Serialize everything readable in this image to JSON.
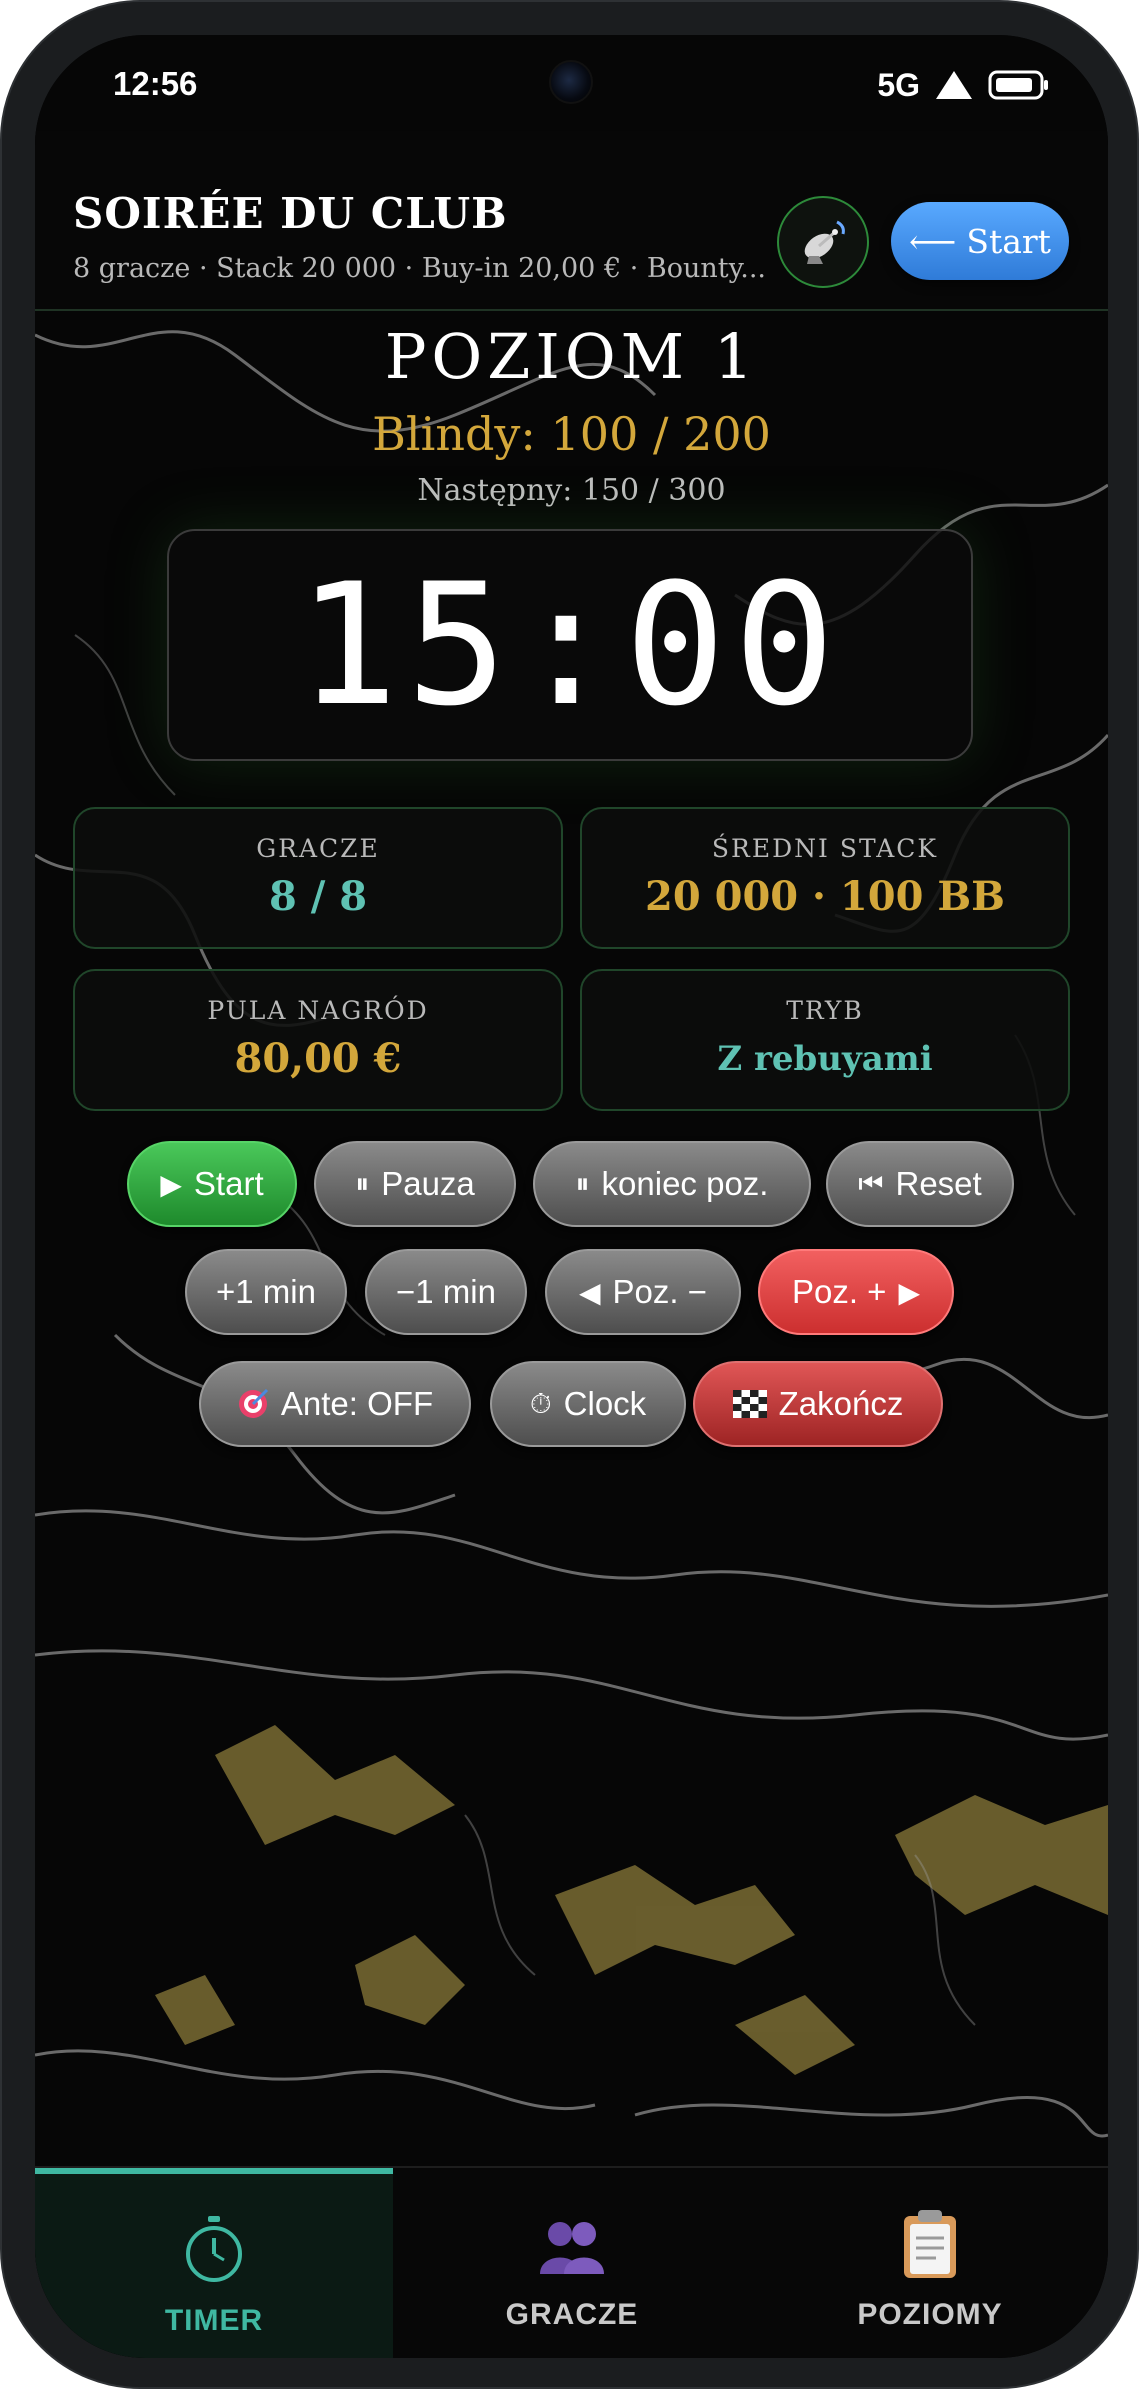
{
  "status_bar": {
    "time": "12:56",
    "network": "5G",
    "icons": [
      "signal-icon",
      "battery-icon"
    ]
  },
  "header": {
    "title": "SOIRÉE DU CLUB",
    "subtitle": "8 gracze · Stack 20 000 · Buy-in 20,00 € · Bounty...",
    "cast_icon": "satellite-dish-icon",
    "start_label": "Start",
    "start_icon": "arrow-left-icon",
    "start_color": "#3a8ae6"
  },
  "level": {
    "title": "POZIOM 1",
    "blinds": "Blindy: 100 / 200",
    "next": "Następny: 150 / 300"
  },
  "timer": {
    "display": "15:00"
  },
  "stats": {
    "players": {
      "label": "GRACZE",
      "value": "8 / 8",
      "color": "#5fc2b3"
    },
    "avg_stack": {
      "label": "ŚREDNI STACK",
      "value": "20 000 · 100 BB",
      "color": "#d3a73b"
    },
    "prize_pool": {
      "label": "PULA NAGRÓD",
      "value": "80,00 €",
      "color": "#d3a73b"
    },
    "mode": {
      "label": "TRYB",
      "value": "Z rebuyami",
      "color": "#5fc2b3"
    }
  },
  "controls": {
    "start": {
      "label": "Start",
      "icon": "▶"
    },
    "pause": {
      "label": "Pauza",
      "icon": "⏸"
    },
    "pause_end_level": {
      "label": "koniec poz.",
      "icon": "⏸"
    },
    "reset": {
      "label": "Reset",
      "icon": "⏮"
    },
    "add_minute": {
      "label": "+1 min"
    },
    "sub_minute": {
      "label": "−1 min"
    },
    "level_down": {
      "label": "Poz. −",
      "icon": "◀"
    },
    "level_up": {
      "label": "Poz. +",
      "icon": "▶"
    },
    "ante": {
      "label": "Ante: OFF",
      "icon": "target-icon"
    },
    "clock": {
      "label": "Clock",
      "icon": "⏱"
    },
    "finish": {
      "label": "Zakończ",
      "icon": "checkered-flag-icon"
    }
  },
  "bottom_nav": {
    "items": [
      {
        "label": "TIMER",
        "icon": "stopwatch-icon",
        "active": true,
        "color": "#3fb8a2"
      },
      {
        "label": "GRACZE",
        "icon": "users-icon",
        "active": false,
        "color": "#c9c9c9"
      },
      {
        "label": "POZIOMY",
        "icon": "clipboard-icon",
        "active": false,
        "color": "#c9c9c9"
      }
    ]
  },
  "colors": {
    "accent_gold": "#d3a73b",
    "accent_teal": "#3fb8a2",
    "primary_blue": "#3a8ae6"
  }
}
